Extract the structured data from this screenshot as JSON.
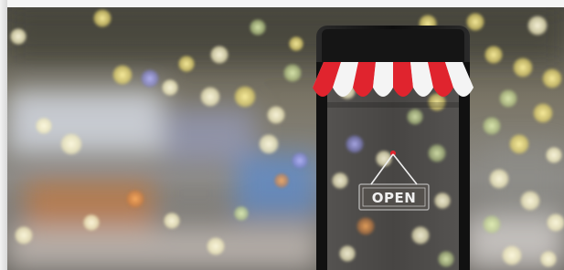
{
  "image": {
    "sign_text": "OPEN",
    "colors": {
      "awning_red": "#e0242e",
      "awning_white": "#f4f4f4",
      "phone_body": "#1a1a1a",
      "background_blur": "#6e6a5e"
    }
  }
}
